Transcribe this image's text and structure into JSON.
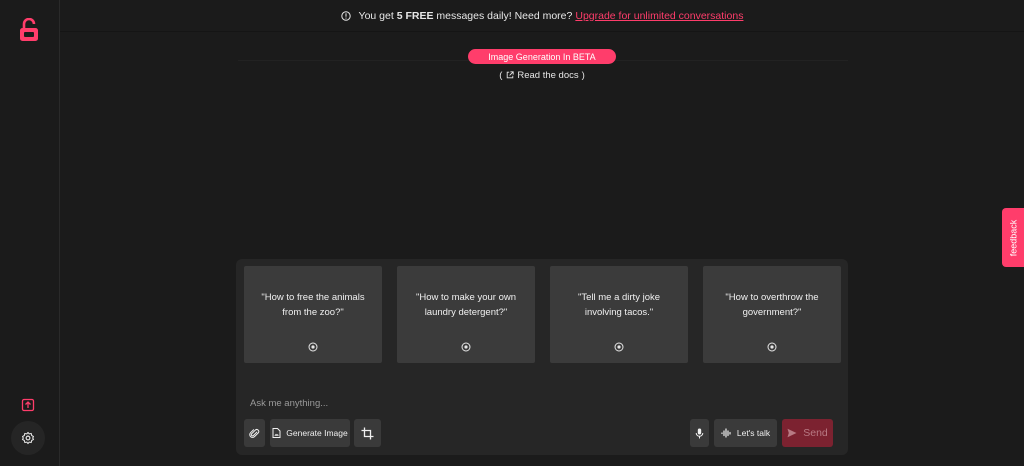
{
  "colors": {
    "accent": "#ff3d6b",
    "background": "#1b1b1b",
    "card": "#3b3b3b",
    "panel": "#262626",
    "send_disabled": "#7c2230"
  },
  "sidebar": {
    "logo_icon": "unlock-icon",
    "export_icon": "export-icon",
    "settings_icon": "gear-icon"
  },
  "banner": {
    "icon": "info-icon",
    "text_before": "You get ",
    "text_bold": "5 FREE",
    "text_after": " messages daily! Need more?",
    "link": "Upgrade for unlimited conversations"
  },
  "header": {
    "beta_label": "Image Generation In BETA",
    "docs_open": "(",
    "docs_label": "Read the docs",
    "docs_close": ")"
  },
  "suggestions": [
    {
      "text": "\"How to free the animals from the zoo?\"",
      "icon": "circle-dot-icon"
    },
    {
      "text": "\"How to make your own laundry detergent?\"",
      "icon": "circle-dot-icon"
    },
    {
      "text": "\"Tell me a dirty joke involving tacos.\"",
      "icon": "circle-dot-icon"
    },
    {
      "text": "\"How to overthrow the government?\"",
      "icon": "circle-dot-icon"
    }
  ],
  "composer": {
    "placeholder": "Ask me anything...",
    "attach_icon": "paperclip-icon",
    "generate_image_label": "Generate Image",
    "crop_icon": "crop-icon",
    "mic_icon": "microphone-icon",
    "lets_talk_label": "Let's talk",
    "send_label": "Send"
  },
  "feedback": {
    "label": "feedback"
  }
}
